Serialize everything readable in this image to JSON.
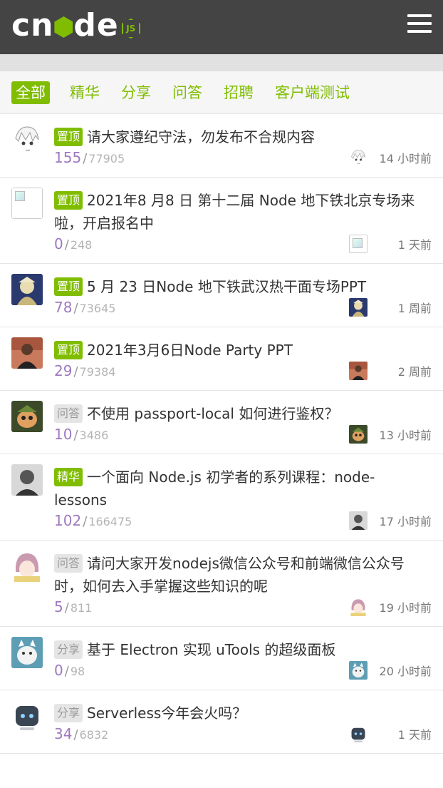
{
  "header": {
    "logo_text": "cnode",
    "logo_badge": "JS",
    "menu_icon": "hamburger-menu-icon"
  },
  "tabs": [
    {
      "label": "全部",
      "active": true
    },
    {
      "label": "精华"
    },
    {
      "label": "分享"
    },
    {
      "label": "问答"
    },
    {
      "label": "招聘"
    },
    {
      "label": "客户端测试"
    }
  ],
  "topics": [
    {
      "tag": "置顶",
      "tag_type": "top",
      "title": "请大家遵纪守法，勿发布不合规内容",
      "replies": "155",
      "views": "77905",
      "time": "14 小时前",
      "avatar": "anime-sketch-avatar"
    },
    {
      "tag": "置顶",
      "tag_type": "top",
      "title": "2021年8 月8 日 第十二届 Node 地下铁北京专场来啦，开启报名中",
      "replies": "0",
      "views": "248",
      "time": "1 天前",
      "avatar": "broken-image-avatar"
    },
    {
      "tag": "置顶",
      "tag_type": "top",
      "title": "5 月 23 日Node 地下铁武汉热干面专场PPT",
      "replies": "78",
      "views": "73645",
      "time": "1 周前",
      "avatar": "game-character-avatar"
    },
    {
      "tag": "置顶",
      "tag_type": "top",
      "title": "2021年3月6日Node Party PPT",
      "replies": "29",
      "views": "79384",
      "time": "2 周前",
      "avatar": "person-photo-avatar"
    },
    {
      "tag": "问答",
      "tag_type": "plain",
      "title": "不使用 passport-local 如何进行鉴权？",
      "replies": "10",
      "views": "3486",
      "time": "13 小时前",
      "avatar": "teemo-avatar"
    },
    {
      "tag": "精华",
      "tag_type": "good",
      "title": "一个面向 Node.js 初学者的系列课程：node-lessons",
      "replies": "102",
      "views": "166475",
      "time": "17 小时前",
      "avatar": "bw-photo-avatar"
    },
    {
      "tag": "问答",
      "tag_type": "plain",
      "title": "请问大家开发nodejs微信公众号和前端微信公众号时，如何去入手掌握这些知识的呢",
      "replies": "5",
      "views": "811",
      "time": "19 小时前",
      "avatar": "anime-girl-avatar"
    },
    {
      "tag": "分享",
      "tag_type": "plain",
      "title": "基于 Electron 实现 uTools 的超级面板",
      "replies": "0",
      "views": "98",
      "time": "20 小时前",
      "avatar": "husky-avatar"
    },
    {
      "tag": "分享",
      "tag_type": "plain",
      "title": "Serverless今年会火吗？",
      "replies": "34",
      "views": "6832",
      "time": "1 天前",
      "avatar": "robot-avatar"
    }
  ],
  "colors": {
    "brand_green": "#80bd01",
    "header_bg": "#444444",
    "reply_purple": "#9e78c0"
  }
}
